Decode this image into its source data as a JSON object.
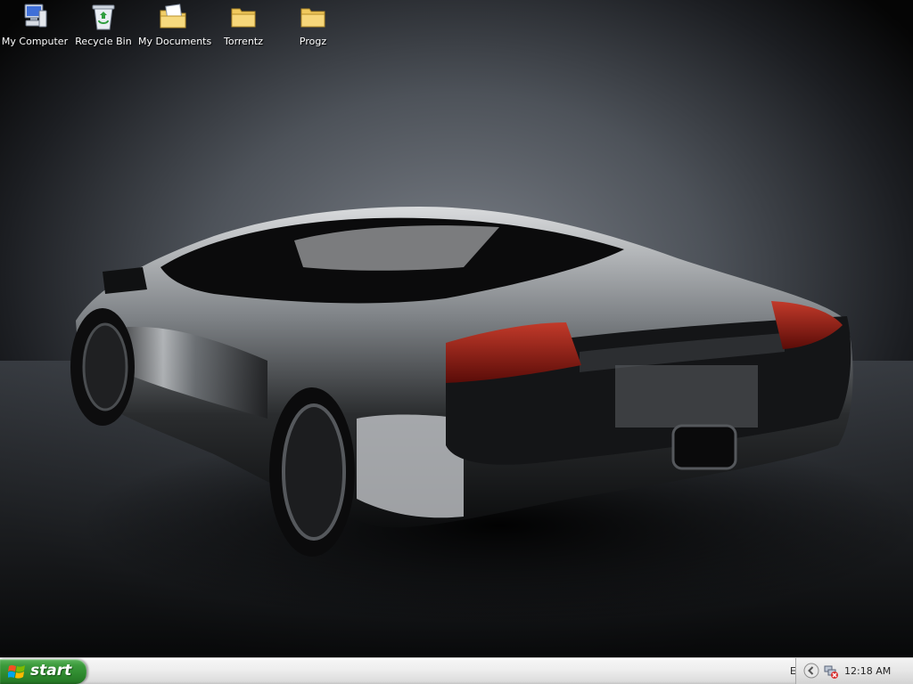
{
  "desktop": {
    "icons": [
      {
        "label": "My Computer",
        "icon": "my-computer-icon"
      },
      {
        "label": "Recycle Bin",
        "icon": "recycle-bin-icon"
      },
      {
        "label": "My Documents",
        "icon": "my-documents-icon"
      },
      {
        "label": "Torrentz",
        "icon": "folder-icon"
      },
      {
        "label": "Progz",
        "icon": "folder-icon"
      }
    ],
    "wallpaper": "lamborghini-wallpaper"
  },
  "taskbar": {
    "start_label": "start",
    "language": "EN",
    "clock": "12:18 AM"
  },
  "colors": {
    "start_green": "#2f8a2f",
    "taskbar_bg": "#eeeeee"
  }
}
